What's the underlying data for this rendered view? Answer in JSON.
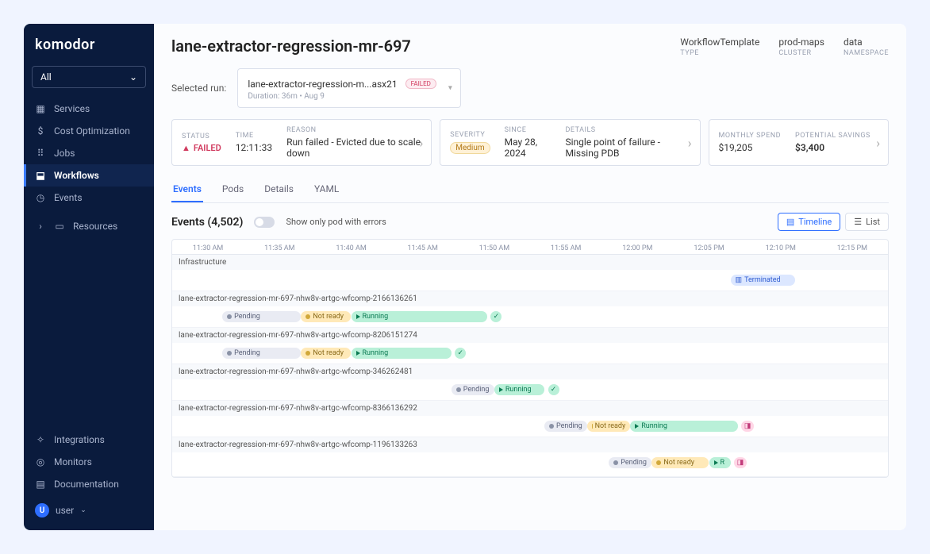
{
  "logo": "komodor",
  "clusterSelector": "All",
  "nav": {
    "services": "Services",
    "costOpt": "Cost Optimization",
    "jobs": "Jobs",
    "workflows": "Workflows",
    "events": "Events",
    "resources": "Resources",
    "integrations": "Integrations",
    "monitors": "Monitors",
    "documentation": "Documentation"
  },
  "user": {
    "initial": "U",
    "name": "user"
  },
  "pageTitle": "lane-extractor-regression-mr-697",
  "meta": {
    "type": {
      "val": "WorkflowTemplate",
      "lbl": "TYPE"
    },
    "cluster": {
      "val": "prod-maps",
      "lbl": "CLUSTER"
    },
    "namespace": {
      "val": "data",
      "lbl": "NAMESPACE"
    }
  },
  "selectedRunLabel": "Selected run:",
  "selectedRun": {
    "name": "lane-extractor-regression-m...asx21",
    "badge": "FAILED",
    "sub": "Duration: 36m  •  Aug 9"
  },
  "cards": {
    "status": {
      "lbl": "STATUS",
      "val": "FAILED"
    },
    "time": {
      "lbl": "TIME",
      "val": "12:11:33"
    },
    "reason": {
      "lbl": "REASON",
      "val": "Run failed - Evicted due to scale down"
    },
    "severity": {
      "lbl": "SEVERITY",
      "val": "Medium"
    },
    "since": {
      "lbl": "SINCE",
      "val": "May 28, 2024"
    },
    "details": {
      "lbl": "DETAILS",
      "val": "Single point of failure - Missing PDB"
    },
    "spend": {
      "lbl": "MONTHLY SPEND",
      "val": "$19,205"
    },
    "savings": {
      "lbl": "POTENTIAL SAVINGS",
      "val": "$3,400"
    }
  },
  "tabs": {
    "events": "Events",
    "pods": "Pods",
    "details": "Details",
    "yaml": "YAML"
  },
  "eventsTitle": "Events (4,502)",
  "eventsCount": 4502,
  "toggleLabel": "Show only pod with errors",
  "viewButtons": {
    "timeline": "Timeline",
    "list": "List"
  },
  "timeTicks": [
    "11:30 AM",
    "11:35 AM",
    "11:40 AM",
    "11:45 AM",
    "11:50 AM",
    "11:55 AM",
    "12:00 PM",
    "12:05 PM",
    "12:10 PM",
    "12:15 PM"
  ],
  "rows": {
    "infra": "Infrastructure",
    "terminated": "Terminated",
    "r1": "lane-extractor-regression-mr-697-nhw8v-artgc-wfcomp-2166136261",
    "r2": "lane-extractor-regression-mr-697-nhw8v-artgc-wfcomp-8206151274",
    "r3": "lane-extractor-regression-mr-697-nhw8v-artgc-wfcomp-346262481",
    "r4": "lane-extractor-regression-mr-697-nhw8v-artgc-wfcomp-8366136292",
    "r5": "lane-extractor-regression-mr-697-nhw8v-artgc-wfcomp-1196133263",
    "pending": "Pending",
    "notready": "Not ready",
    "running": "Running",
    "r": "R"
  }
}
